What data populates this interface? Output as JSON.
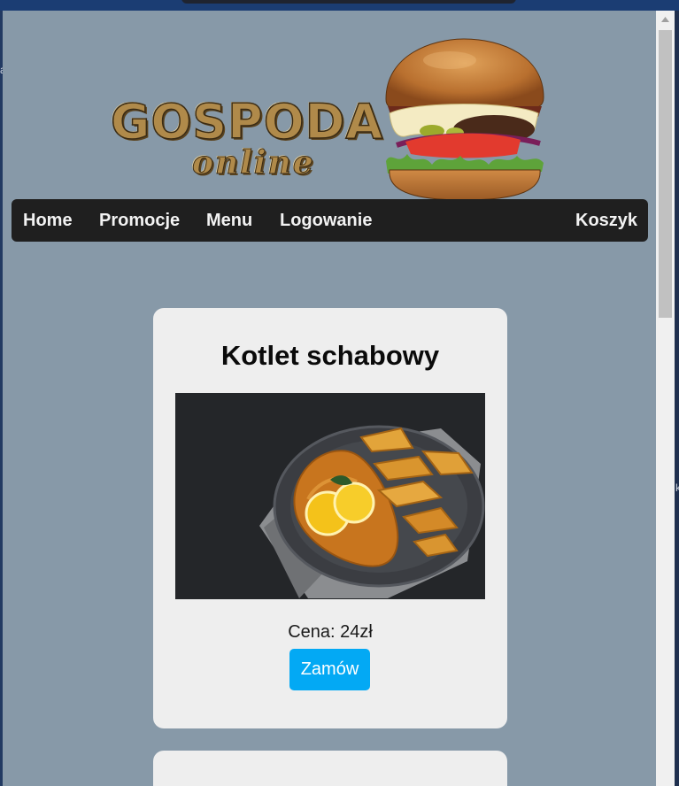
{
  "brand": {
    "logo_main": "GOSPODA",
    "logo_sub": "online"
  },
  "nav": {
    "items": [
      "Home",
      "Promocje",
      "Menu",
      "Logowanie"
    ],
    "cart": "Koszyk"
  },
  "products": [
    {
      "name": "Kotlet schabowy",
      "image": "breaded-cutlet-with-potato-wedges-photo",
      "price": "Cena: 24zł",
      "order_label": "Zamów"
    }
  ],
  "colors": {
    "page_bg": "#8799a8",
    "nav_bg": "#1f1f1f",
    "card_bg": "#eeeeee",
    "order_button": "#03a9f4"
  }
}
